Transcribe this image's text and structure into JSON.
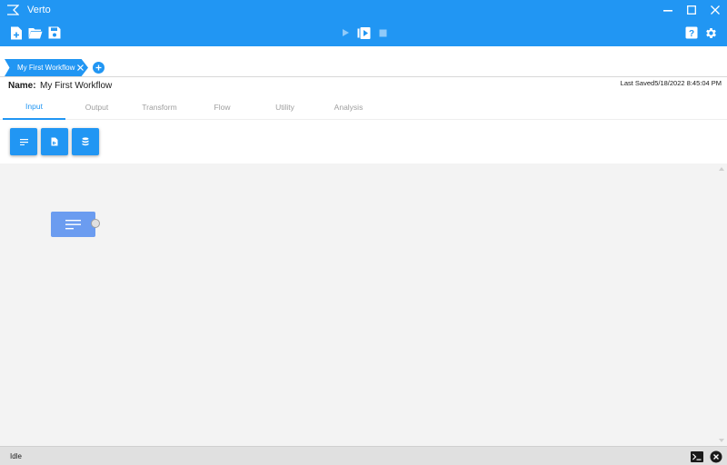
{
  "window": {
    "title": "Verto",
    "app_icon": "sigma-icon",
    "controls": [
      "minimize-icon",
      "maximize-icon",
      "close-icon"
    ]
  },
  "toolbar": {
    "left_icons": [
      "new-file-icon",
      "open-folder-icon",
      "save-icon"
    ],
    "center_icons": [
      "play-icon",
      "run-step-icon",
      "stop-icon"
    ],
    "right_icons": [
      "help-icon",
      "gear-icon"
    ]
  },
  "tabs": [
    {
      "label": "My First Workflow",
      "active": true
    }
  ],
  "workflow": {
    "name_label": "Name:",
    "name": "My First Workflow",
    "last_saved_label": "Last Saved",
    "last_saved_value": "5/18/2022 8:45:04 PM"
  },
  "categories": [
    {
      "label": "Input",
      "active": true
    },
    {
      "label": "Output",
      "active": false
    },
    {
      "label": "Transform",
      "active": false
    },
    {
      "label": "Flow",
      "active": false
    },
    {
      "label": "Utility",
      "active": false
    },
    {
      "label": "Analysis",
      "active": false
    }
  ],
  "node_buttons": [
    "text-lines-icon",
    "file-icon",
    "database-icon"
  ],
  "canvas": {
    "nodes": [
      {
        "icon": "text-lines-icon",
        "color": "#6b9cf0"
      }
    ]
  },
  "status": {
    "text": "Idle",
    "icons": [
      "terminal-icon",
      "close-circle-icon"
    ]
  },
  "colors": {
    "accent": "#2196f3",
    "canvas_bg": "#f3f3f3",
    "node": "#6b9cf0"
  }
}
